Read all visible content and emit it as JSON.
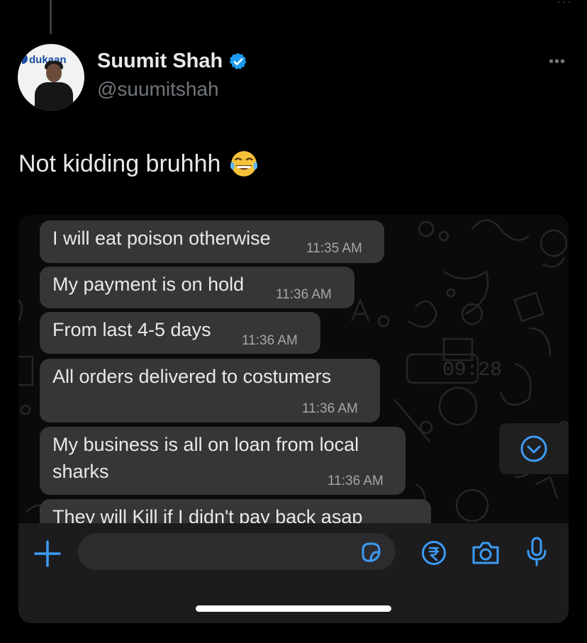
{
  "tweet": {
    "author": {
      "display_name": "Suumit Shah",
      "handle": "@suumitshah",
      "verified": true,
      "avatar_logo_text": "dukaan"
    },
    "text": "Not kidding bruhhh",
    "emoji": "face-with-tears-of-joy-icon"
  },
  "chat": {
    "messages": [
      {
        "text": "I will eat poison otherwise",
        "time": "11:35 AM"
      },
      {
        "text": "My payment is on hold",
        "time": "11:36 AM"
      },
      {
        "text": "From last 4-5 days",
        "time": "11:36 AM"
      },
      {
        "text": "All orders delivered to costumers",
        "time": "11:36 AM"
      },
      {
        "text": "My business is all on loan from local",
        "text_line2": "sharks",
        "time": "11:36 AM"
      },
      {
        "text": "They will Kill if  I didn't pay back asap",
        "time": ""
      }
    ],
    "doodle_clock_text": "09:28"
  },
  "colors": {
    "accent": "#1d9bf0",
    "wa_icon_blue": "#3d9bf5",
    "bubble": "#363636",
    "bar": "#1c1c1e"
  }
}
